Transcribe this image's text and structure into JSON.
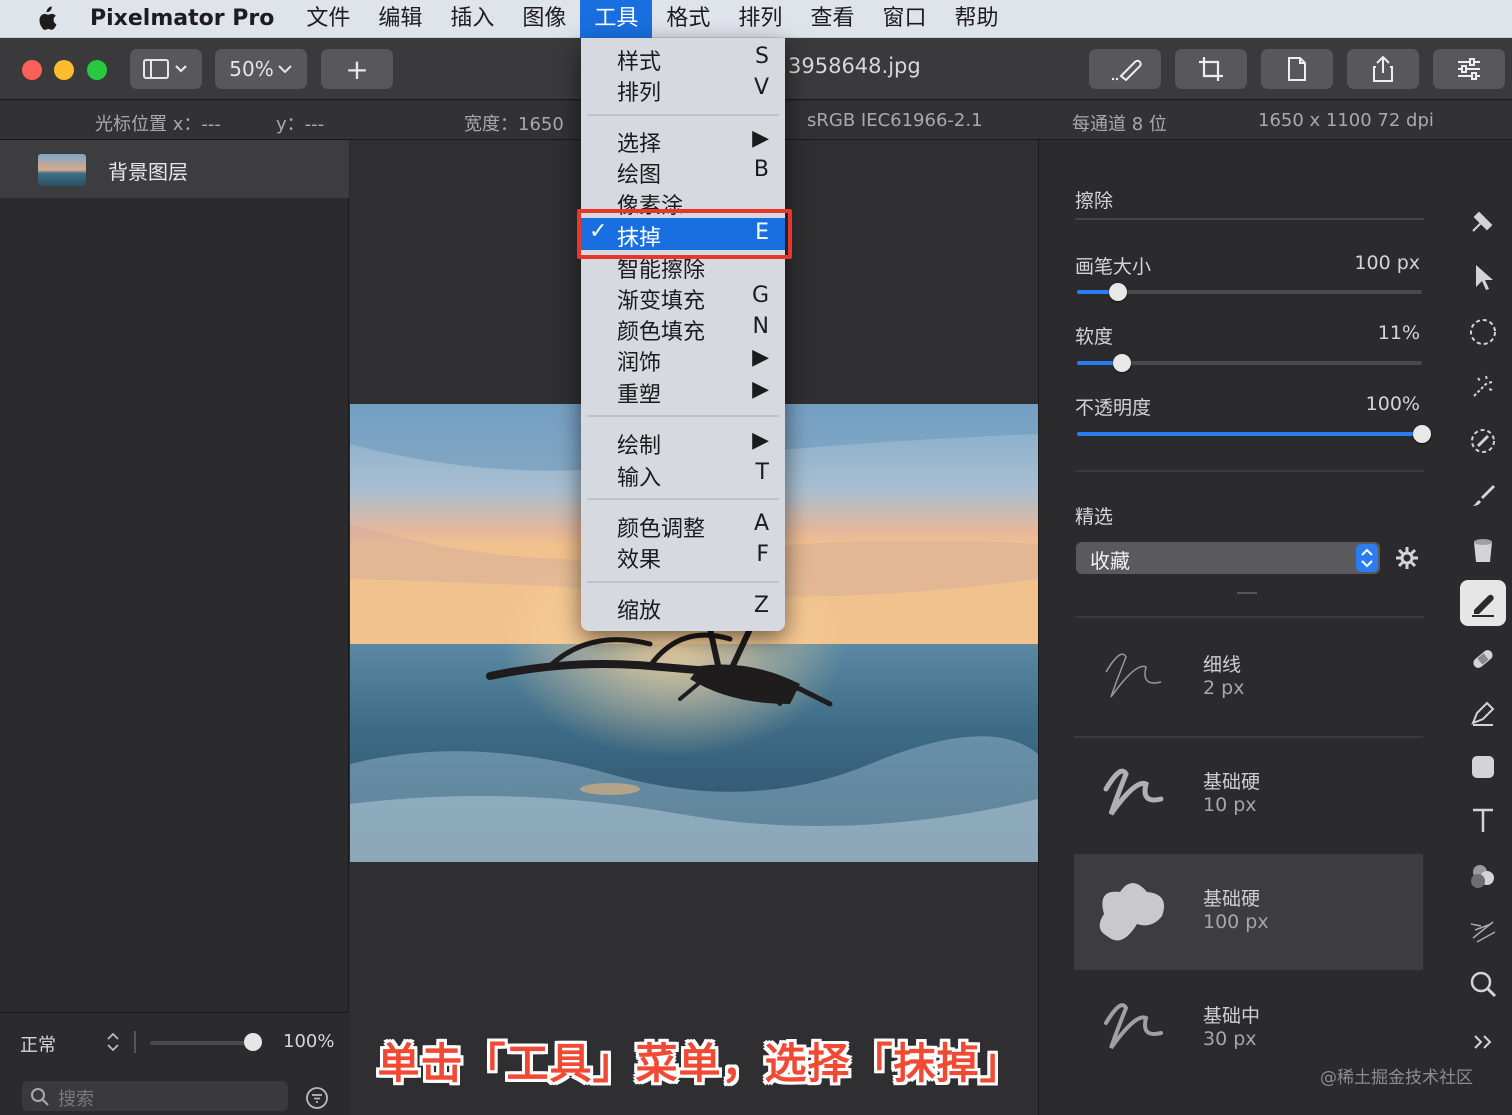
{
  "menubar": {
    "app_name": "Pixelmator Pro",
    "items": [
      "文件",
      "编辑",
      "插入",
      "图像",
      "工具",
      "格式",
      "排列",
      "查看",
      "窗口",
      "帮助"
    ]
  },
  "toolbar": {
    "zoom": "50%",
    "add_label": "+",
    "doc_title": "3958648.jpg"
  },
  "infobar": {
    "cursor_x": "光标位置 x：---",
    "cursor_y": "y：---",
    "width": "宽度：1650",
    "color_profile": "sRGB IEC61966-2.1",
    "bits": "每通道 8 位",
    "size": "1650 x 1100 72 dpi"
  },
  "layers": {
    "layer_name": "背景图层",
    "blend_mode": "正常",
    "opacity": "100%",
    "search_placeholder": "搜索"
  },
  "tools_menu": {
    "items": [
      {
        "label": "样式",
        "shortcut": "S"
      },
      {
        "label": "排列",
        "shortcut": "V"
      },
      {
        "label": "选择",
        "shortcut": "▶"
      },
      {
        "label": "绘图",
        "shortcut": "B"
      },
      {
        "label": "像素涂",
        "shortcut": ""
      },
      {
        "label": "抹掉",
        "shortcut": "E",
        "checked": "✓"
      },
      {
        "label": "智能擦除",
        "shortcut": ""
      },
      {
        "label": "渐变填充",
        "shortcut": "G"
      },
      {
        "label": "颜色填充",
        "shortcut": "N"
      },
      {
        "label": "润饰",
        "shortcut": "▶"
      },
      {
        "label": "重塑",
        "shortcut": "▶"
      },
      {
        "label": "绘制",
        "shortcut": "▶"
      },
      {
        "label": "输入",
        "shortcut": "T"
      },
      {
        "label": "颜色调整",
        "shortcut": "A"
      },
      {
        "label": "效果",
        "shortcut": "F"
      },
      {
        "label": "缩放",
        "shortcut": "Z"
      }
    ]
  },
  "eraser_panel": {
    "title": "擦除",
    "brush_size_label": "画笔大小",
    "brush_size_value": "100 px",
    "brush_size_level": 0.12,
    "softness_label": "软度",
    "softness_value": "11%",
    "softness_level": 0.13,
    "opacity_label": "不透明度",
    "opacity_value": "100%",
    "opacity_level": 1.0,
    "presets_label": "精选",
    "presets_selected": "收藏",
    "brushes": [
      {
        "name": "细线",
        "size": "2 px"
      },
      {
        "name": "基础硬",
        "size": "10 px"
      },
      {
        "name": "基础硬",
        "size": "100 px"
      },
      {
        "name": "基础中",
        "size": "30 px"
      }
    ]
  },
  "caption": "单击「工具」菜单，选择「抹掉」",
  "watermark": "@稀土掘金技术社区",
  "colors": {
    "accent": "#1a6fe0",
    "highlight": "#e8362d",
    "caption": "#f04a35"
  }
}
